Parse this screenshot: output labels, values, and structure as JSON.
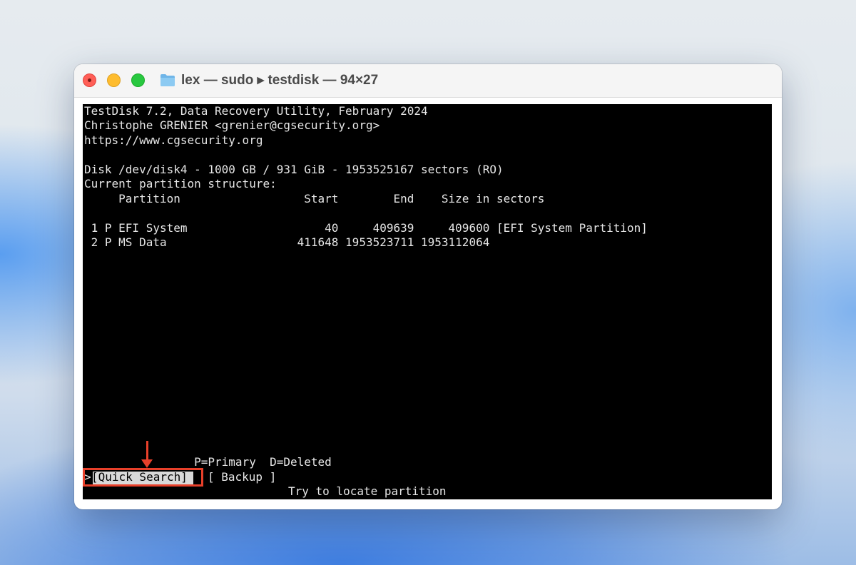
{
  "window": {
    "title": "lex — sudo ▸ testdisk — 94×27"
  },
  "terminal": {
    "lines": [
      "TestDisk 7.2, Data Recovery Utility, February 2024",
      "Christophe GRENIER <grenier@cgsecurity.org>",
      "https://www.cgsecurity.org",
      "",
      "Disk /dev/disk4 - 1000 GB / 931 GiB - 1953525167 sectors (RO)",
      "Current partition structure:",
      "     Partition                  Start        End    Size in sectors",
      "",
      " 1 P EFI System                    40     409639     409600 [EFI System Partition]",
      " 2 P MS Data                   411648 1953523711 1953112064"
    ],
    "legend": "                P=Primary  D=Deleted",
    "prompt_marker": ">",
    "quick_search_label": "[Quick Search]",
    "backup_label": "[ Backup ]",
    "hint": "Try to locate partition"
  },
  "annotation": {
    "arrow_color": "#e8402a",
    "highlight_color": "#e8402a"
  }
}
